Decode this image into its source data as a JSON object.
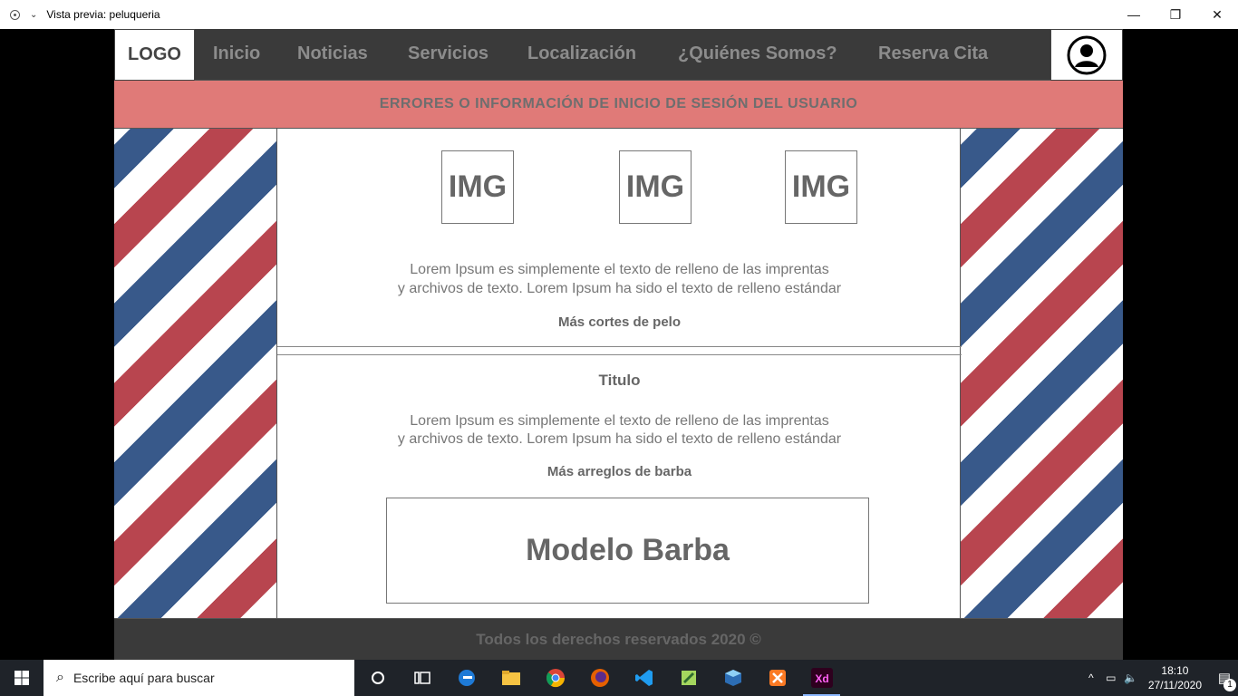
{
  "window": {
    "title": "Vista previa: peluqueria",
    "controls": {
      "minimize": "—",
      "restore": "❐",
      "close": "✕"
    }
  },
  "nav": {
    "logo": "LOGO",
    "items": [
      "Inicio",
      "Noticias",
      "Servicios",
      "Localización",
      "¿Quiénes Somos?",
      "Reserva Cita"
    ],
    "user_icon": "user-avatar-icon"
  },
  "alert": {
    "text": "ERRORES O INFORMACIÓN DE INICIO DE SESIÓN DEL USUARIO"
  },
  "section1": {
    "images": [
      "IMG",
      "IMG",
      "IMG"
    ],
    "paragraph_line1": "Lorem Ipsum es simplemente el texto de relleno de las imprentas",
    "paragraph_line2": "y archivos de texto. Lorem Ipsum ha sido el texto de relleno estándar",
    "link": "Más cortes de pelo"
  },
  "section2": {
    "title": "Titulo",
    "paragraph_line1": "Lorem Ipsum es simplemente el texto de relleno de las imprentas",
    "paragraph_line2": "y archivos de texto. Lorem Ipsum ha sido el texto de relleno estándar",
    "link": "Más arreglos de barba",
    "model": "Modelo Barba"
  },
  "footer": {
    "text": "Todos los derechos reservados 2020 ©"
  },
  "taskbar": {
    "search_placeholder": "Escribe aquí para buscar",
    "time": "18:10",
    "date": "27/11/2020",
    "notification_count": "1",
    "apps": [
      "cortana-icon",
      "task-view-icon",
      "edge-icon",
      "file-explorer-icon",
      "chrome-icon",
      "firefox-icon",
      "vscode-icon",
      "notepad-plus-icon",
      "virtualbox-icon",
      "xampp-icon",
      "adobe-xd-icon"
    ]
  },
  "colors": {
    "nav_bg": "#3a3a3a",
    "alert_bg": "#e07a78",
    "stripe_red": "#b8454f",
    "stripe_blue": "#38598a",
    "xd_bg": "#2e001e",
    "xd_fg": "#ff61f6"
  }
}
